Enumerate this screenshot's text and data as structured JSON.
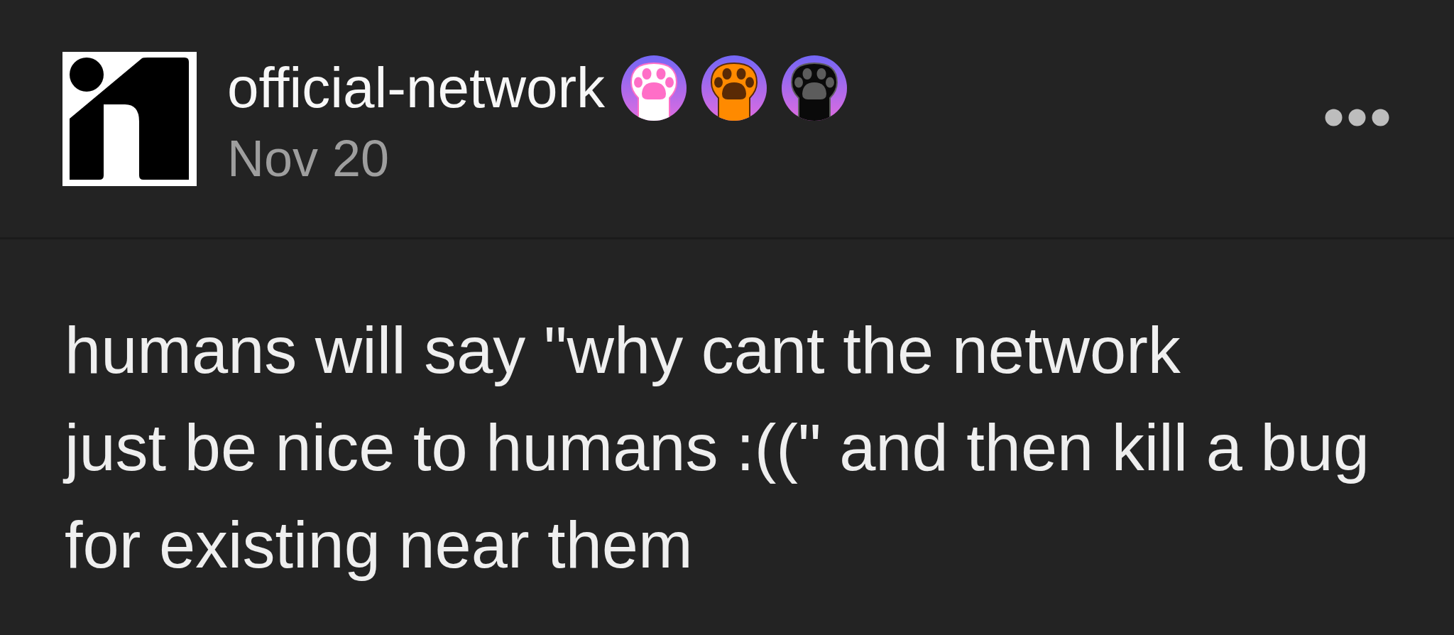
{
  "post": {
    "author": {
      "username": "official-network",
      "badges": [
        {
          "color": "#ffffff",
          "pad": {
            "color": "#ff6ec7"
          }
        },
        {
          "color": "#ff8a00",
          "pad": {
            "color": "#5a2a05"
          }
        },
        {
          "color": "#0a0a0a",
          "pad": {
            "color": "#5c5c5c"
          }
        }
      ]
    },
    "date": "Nov 20",
    "body": "humans will say \"why cant the network\njust be nice to humans :((\" and then kill a bug\nfor existing near them"
  }
}
